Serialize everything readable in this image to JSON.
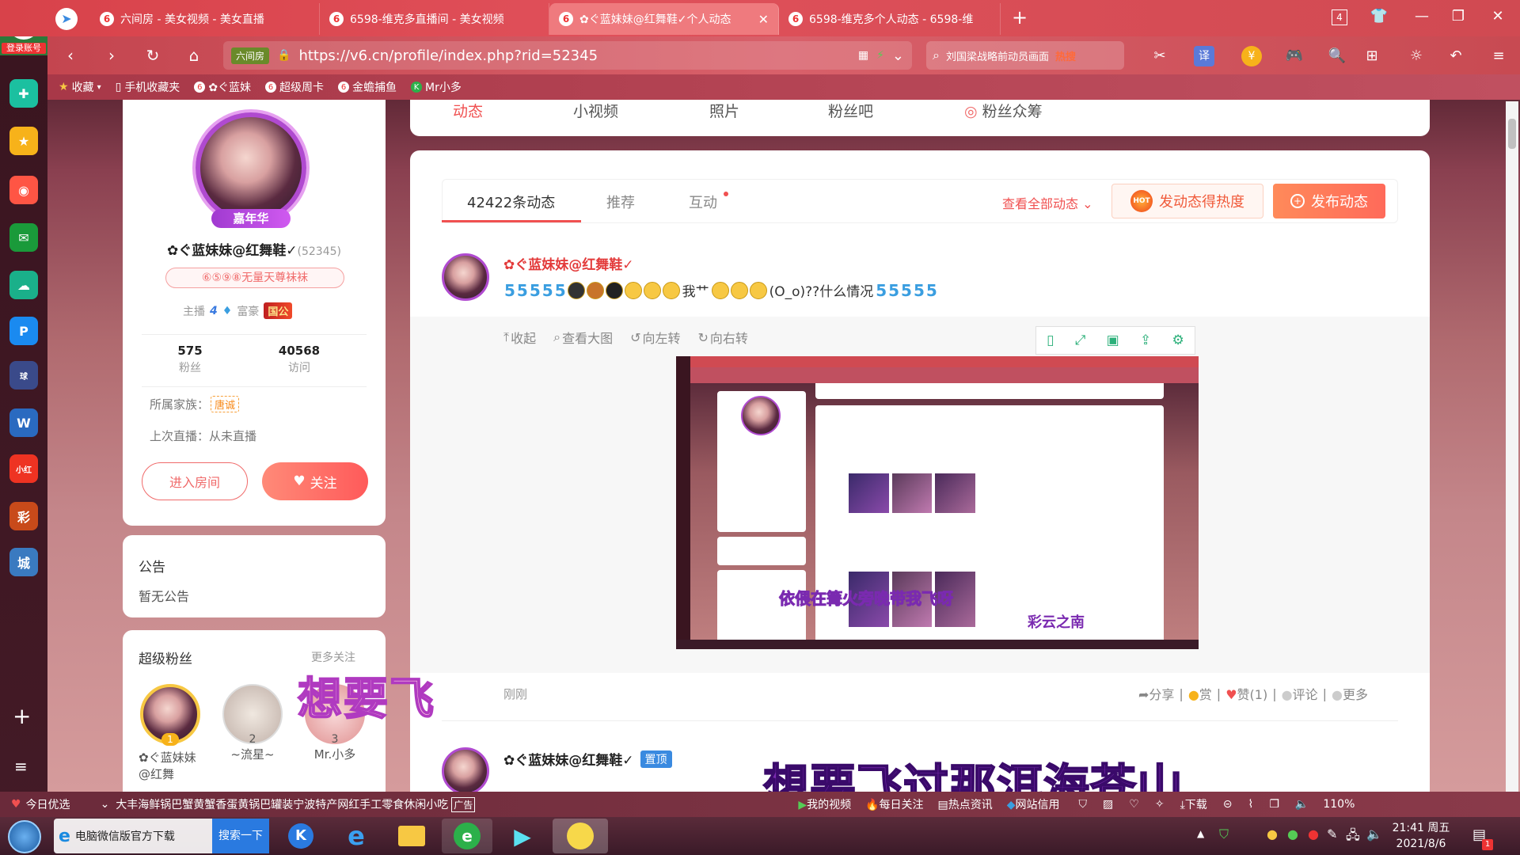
{
  "browser": {
    "tabs": [
      {
        "label": "六间房 - 美女视频 - 美女直播"
      },
      {
        "label": "6598-维克多直播间 - 美女视频"
      },
      {
        "label": "✿ぐ蓝妹妹@红舞鞋✓个人动态"
      },
      {
        "label": "6598-维克多个人动态 - 6598-维"
      }
    ],
    "url": "https://v6.cn/profile/index.php?rid=52345",
    "url_badge": "六间房",
    "search_text": "刘国梁战略前动员画面",
    "search_badge": "热搜",
    "tab_count": "4",
    "login_label": "登录账号",
    "bookmarks": [
      {
        "label": "收藏"
      },
      {
        "label": "手机收藏夹"
      },
      {
        "label": "✿ぐ蓝妹"
      },
      {
        "label": "超级周卡"
      },
      {
        "label": "金蟾捕鱼"
      },
      {
        "label": "Mr小多"
      }
    ]
  },
  "profile": {
    "nav_tabs": [
      "动态",
      "小视频",
      "照片",
      "粉丝吧",
      "粉丝众筹"
    ],
    "avatar_badge": "嘉年华",
    "name": "✿ぐ蓝妹妹@红舞鞋✓",
    "rid": "(52345)",
    "title_badge": "⑥⑤⑨⑧无量天尊袜袜",
    "host_label": "主播",
    "host_level": "4",
    "rich_label": "富豪",
    "rich_badge": "国公",
    "fans_count": "575",
    "fans_label": "粉丝",
    "visits_count": "40568",
    "visits_label": "访问",
    "family_label": "所属家族：",
    "family_badge": "唐诚",
    "last_live": "上次直播：从未直播",
    "enter_room": "进入房间",
    "follow": "关注"
  },
  "notice": {
    "title": "公告",
    "content": "暂无公告"
  },
  "superfans": {
    "title": "超级粉丝",
    "more": "更多关注",
    "fans": [
      {
        "rank": "1",
        "name": "✿ぐ蓝妹妹@红舞"
      },
      {
        "rank": "2",
        "name": "~流星~"
      },
      {
        "rank": "3",
        "name": "Mr.小多"
      }
    ]
  },
  "feed": {
    "tabs": [
      {
        "label": "42422条动态"
      },
      {
        "label": "推荐"
      },
      {
        "label": "互动"
      }
    ],
    "view_all": "查看全部动态",
    "heat_btn": "发动态得热度",
    "post_btn": "发布动态",
    "post1": {
      "author": "✿ぐ蓝妹妹@红舞鞋✓",
      "text_mid": "我艹",
      "text_end": "(O_o)??什么情况",
      "time": "刚刚"
    },
    "image_tools": [
      "收起",
      "查看大图",
      "向左转",
      "向右转"
    ],
    "actions": {
      "share": "分享",
      "reward": "赏",
      "like": "赞(1)",
      "comment": "评论",
      "more": "更多"
    },
    "post2": {
      "author": "✿ぐ蓝妹妹@红舞鞋✓",
      "pin_badge": "置顶"
    }
  },
  "overlays": {
    "lyric_short": "想要飞",
    "lyric_long": "想要飞过那洱海苍山",
    "thumb_lyric1": "依偎在篝火旁晚带我飞呀",
    "thumb_lyric2": "彩云之南"
  },
  "statusbar": {
    "today_pick": "今日优选",
    "news": "大丰海鲜锅巴蟹黄蟹香蛋黄锅巴罐装宁波特产网红手工零食休闲小吃",
    "ad_tag": "广告",
    "my_video": "我的视频",
    "daily_focus": "每日关注",
    "hot_news": "热点资讯",
    "web_credit": "网站信用",
    "download": "下载",
    "zoom": "110%"
  },
  "taskbar": {
    "item1": "电脑微信版官方下载",
    "item1_btn": "搜索一下",
    "time": "21:41 周五",
    "date": "2021/8/6",
    "notify_count": "1"
  },
  "colors": {
    "accent": "#ff5a5a",
    "accent_orange": "#ff8a5a",
    "brand_red": "#e33b3b"
  }
}
